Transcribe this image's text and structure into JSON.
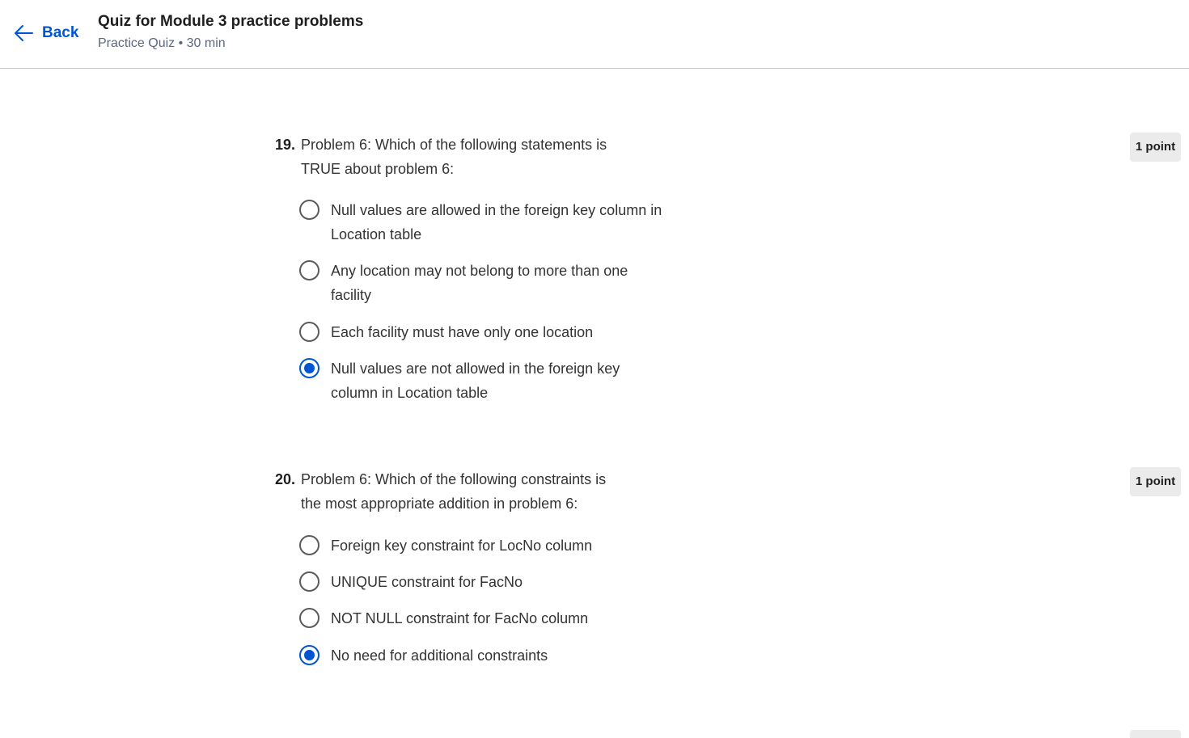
{
  "header": {
    "back_label": "Back",
    "title": "Quiz for Module 3 practice problems",
    "meta": "Practice Quiz • 30 min"
  },
  "questions": [
    {
      "number": "19.",
      "text": "Problem 6: Which of the following statements is TRUE about problem 6:",
      "points": "1 point",
      "options": [
        {
          "label": "Null values are allowed in the foreign key column in Location table",
          "selected": false
        },
        {
          "label": "Any location may not belong to more than one facility",
          "selected": false
        },
        {
          "label": "Each facility must have only one location",
          "selected": false
        },
        {
          "label": "Null values are not allowed in the foreign key column in Location table",
          "selected": true
        }
      ]
    },
    {
      "number": "20.",
      "text": "Problem 6: Which of the following constraints is the most appropriate addition in problem 6:",
      "points": "1 point",
      "options": [
        {
          "label": "Foreign key constraint for LocNo column",
          "selected": false
        },
        {
          "label": "UNIQUE constraint for FacNo",
          "selected": false
        },
        {
          "label": "NOT NULL constraint for FacNo column",
          "selected": false
        },
        {
          "label": "No need for additional constraints",
          "selected": true
        }
      ]
    }
  ],
  "colors": {
    "accent": "#0056d2",
    "badge_bg": "#ebebeb"
  },
  "icons": {
    "back": "arrow-left-icon"
  }
}
